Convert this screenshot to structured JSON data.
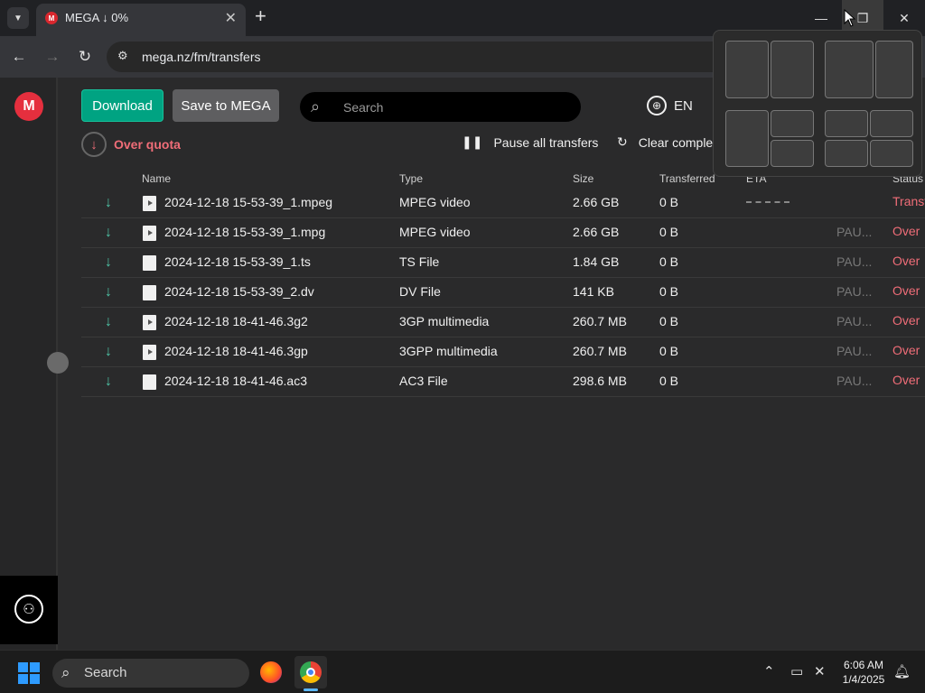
{
  "browser": {
    "tab_title": "MEGA ↓ 0%",
    "favicon_letter": "M",
    "url": "mega.nz/fm/transfers",
    "new_tab": "+",
    "tab_close": "✕"
  },
  "toolbar": {
    "download_label": "Download",
    "save_label": "Save to MEGA",
    "search_placeholder": "Search",
    "language": "EN",
    "over_quota": "Over quota",
    "pause_all": "Pause all transfers",
    "clear_completed": "Clear comple"
  },
  "table": {
    "columns": [
      "Name",
      "Type",
      "Size",
      "Transferred",
      "ETA",
      "Status"
    ],
    "rows": [
      {
        "name": "2024-12-18 15-53-39_1.mpeg",
        "type": "MPEG video",
        "size": "2.66 GB",
        "transferred": "0 B",
        "paused": "",
        "status": "Transf",
        "icon": "video-file-icon"
      },
      {
        "name": "2024-12-18 15-53-39_1.mpg",
        "type": "MPEG video",
        "size": "2.66 GB",
        "transferred": "0 B",
        "paused": "PAU...",
        "status": "Over",
        "icon": "video-file-icon"
      },
      {
        "name": "2024-12-18 15-53-39_1.ts",
        "type": "TS File",
        "size": "1.84 GB",
        "transferred": "0 B",
        "paused": "PAU...",
        "status": "Over",
        "icon": "file-icon"
      },
      {
        "name": "2024-12-18 15-53-39_2.dv",
        "type": "DV File",
        "size": "141 KB",
        "transferred": "0 B",
        "paused": "PAU...",
        "status": "Over",
        "icon": "file-icon"
      },
      {
        "name": "2024-12-18 18-41-46.3g2",
        "type": "3GP multimedia",
        "size": "260.7 MB",
        "transferred": "0 B",
        "paused": "PAU...",
        "status": "Over",
        "icon": "video-file-icon"
      },
      {
        "name": "2024-12-18 18-41-46.3gp",
        "type": "3GPP multimedia",
        "size": "260.7 MB",
        "transferred": "0 B",
        "paused": "PAU...",
        "status": "Over",
        "icon": "video-file-icon"
      },
      {
        "name": "2024-12-18 18-41-46.ac3",
        "type": "AC3 File",
        "size": "298.6 MB",
        "transferred": "0 B",
        "paused": "PAU...",
        "status": "Over",
        "icon": "file-icon"
      }
    ]
  },
  "taskbar": {
    "search_label": "Search",
    "time": "6:06 AM",
    "date": "1/4/2025"
  },
  "colors": {
    "accent_green": "#00a382",
    "over_quota_red": "#f06d78",
    "mega_red": "#e52f3e"
  }
}
